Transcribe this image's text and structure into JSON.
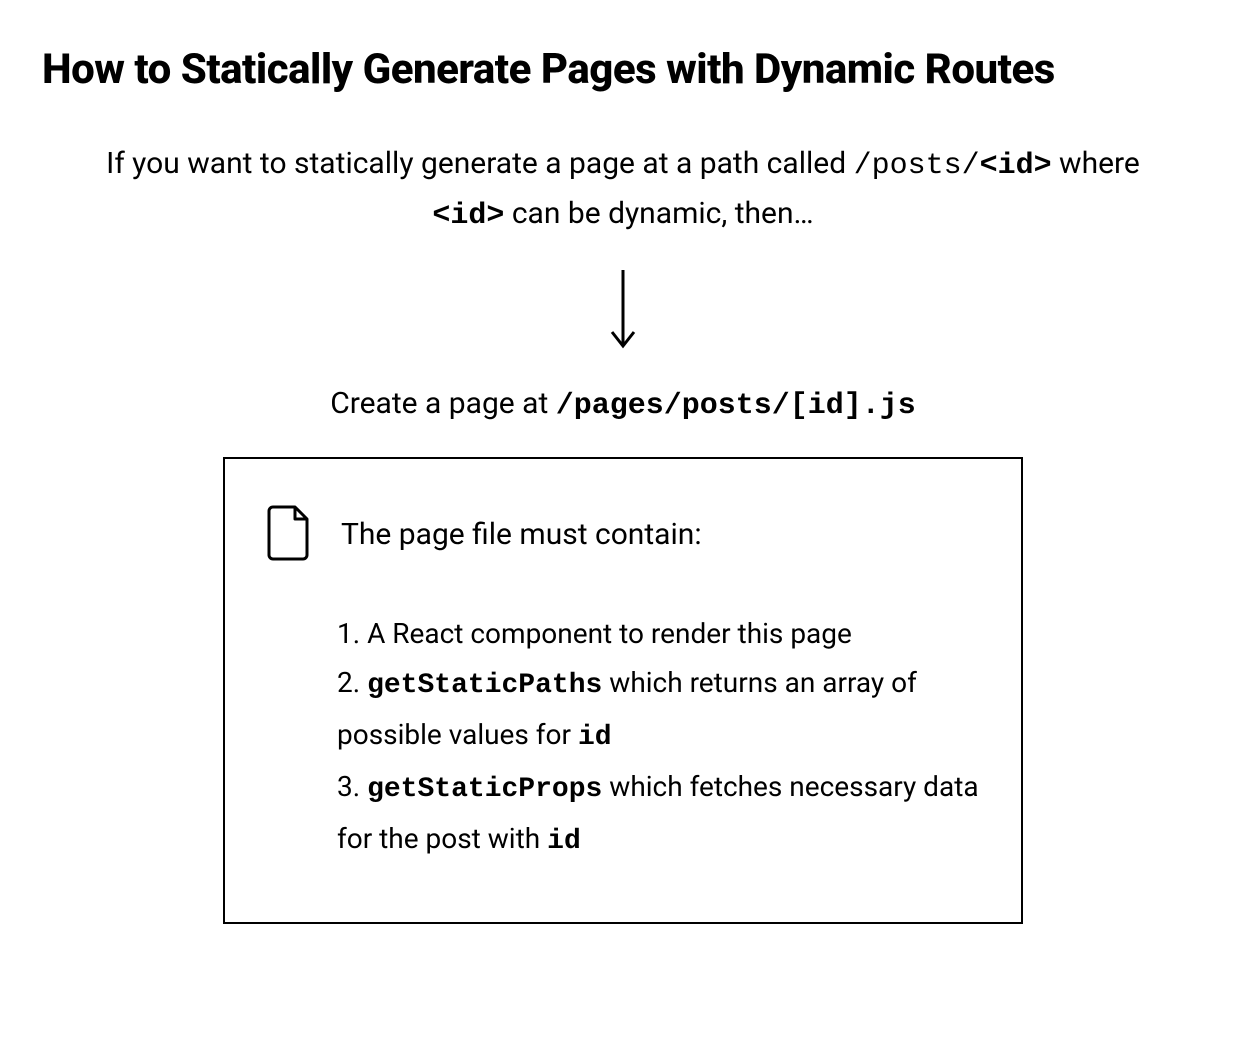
{
  "heading": "How to Statically Generate Pages with Dynamic Routes",
  "intro": {
    "segments": [
      {
        "text": "If you want to statically generate a page at a path called ",
        "cls": ""
      },
      {
        "text": "/posts/",
        "cls": "code"
      },
      {
        "text": "<id>",
        "cls": "code bold"
      },
      {
        "text": " where ",
        "cls": ""
      },
      {
        "text": "<id>",
        "cls": "code bold"
      },
      {
        "text": " can be dynamic, then…",
        "cls": ""
      }
    ]
  },
  "create_line": {
    "segments": [
      {
        "text": "Create a page at ",
        "cls": ""
      },
      {
        "text": "/pages/posts/[id].js",
        "cls": "code bold"
      }
    ]
  },
  "box": {
    "must_contain": "The page file must contain:",
    "items": [
      {
        "segments": [
          {
            "text": "A React component to render this page",
            "cls": ""
          }
        ]
      },
      {
        "segments": [
          {
            "text": "getStaticPaths",
            "cls": "code bold"
          },
          {
            "text": " which returns an array of possible values for ",
            "cls": ""
          },
          {
            "text": "id",
            "cls": "code bold"
          }
        ]
      },
      {
        "segments": [
          {
            "text": "getStaticProps",
            "cls": "code bold"
          },
          {
            "text": " which fetches necessary data for the post with ",
            "cls": ""
          },
          {
            "text": "id",
            "cls": "code bold"
          }
        ]
      }
    ]
  }
}
